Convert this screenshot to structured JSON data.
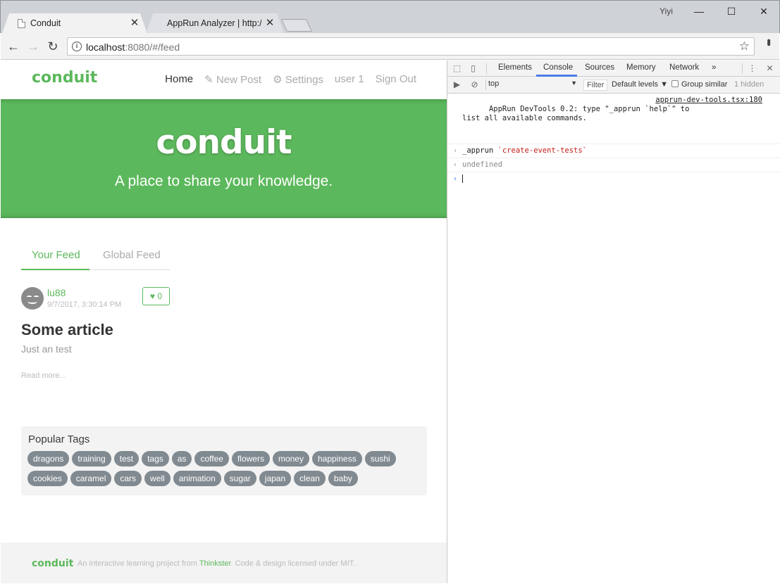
{
  "window": {
    "tabs": [
      {
        "title": "Conduit",
        "close": "✕"
      },
      {
        "title": "AppRun Analyzer | http://",
        "close": "✕"
      }
    ],
    "user": "Yiyi",
    "buttons": {
      "minimize": "—",
      "maximize": "☐",
      "close": "✕"
    }
  },
  "toolbar": {
    "back": "←",
    "forward": "→",
    "reload": "↻",
    "info": "i",
    "url_host": "localhost",
    "url_rest": ":8080/#/feed",
    "star": "☆",
    "menu": "•••"
  },
  "app": {
    "brand": "conduit",
    "nav": {
      "home": "Home",
      "new_post": "✎ New Post",
      "settings": "⚙ Settings",
      "user": "user 1",
      "sign_out": "Sign Out"
    },
    "banner": {
      "title": "conduit",
      "subtitle": "A place to share your knowledge."
    },
    "feed_tabs": {
      "your": "Your Feed",
      "global": "Global Feed"
    },
    "article": {
      "author": "lu88",
      "date": "9/7/2017, 3:30:14 PM",
      "likes": "♥ 0",
      "title": "Some article",
      "description": "Just an test",
      "read_more": "Read more..."
    },
    "tags": {
      "title": "Popular Tags",
      "row1": [
        "dragons",
        "training",
        "test",
        "tags",
        "as",
        "coffee",
        "flowers",
        "money",
        "happiness",
        "sushi"
      ],
      "row2": [
        "cookies",
        "caramel",
        "cars",
        "well",
        "animation",
        "sugar",
        "japan",
        "clean",
        "baby"
      ]
    },
    "footer": {
      "brand": "conduit",
      "text_before": "An interactive learning project from ",
      "link": "Thinkster",
      "text_after": ". Code & design licensed under MIT."
    }
  },
  "devtools": {
    "tabs": [
      "Elements",
      "Console",
      "Sources",
      "Memory",
      "Network",
      "»"
    ],
    "context": "top",
    "filter": "Filter",
    "levels": "Default levels ▼",
    "group_similar": "Group similar",
    "hidden": "1 hidden",
    "lines": [
      {
        "text": "AppRun DevTools 0.2: type \"_apprun `help`\" to\nlist all available commands.",
        "source": "apprun-dev-tools.tsx:180"
      },
      {
        "prefix": "_apprun ",
        "string": "`create-event-tests`"
      },
      {
        "result": "undefined"
      }
    ]
  }
}
